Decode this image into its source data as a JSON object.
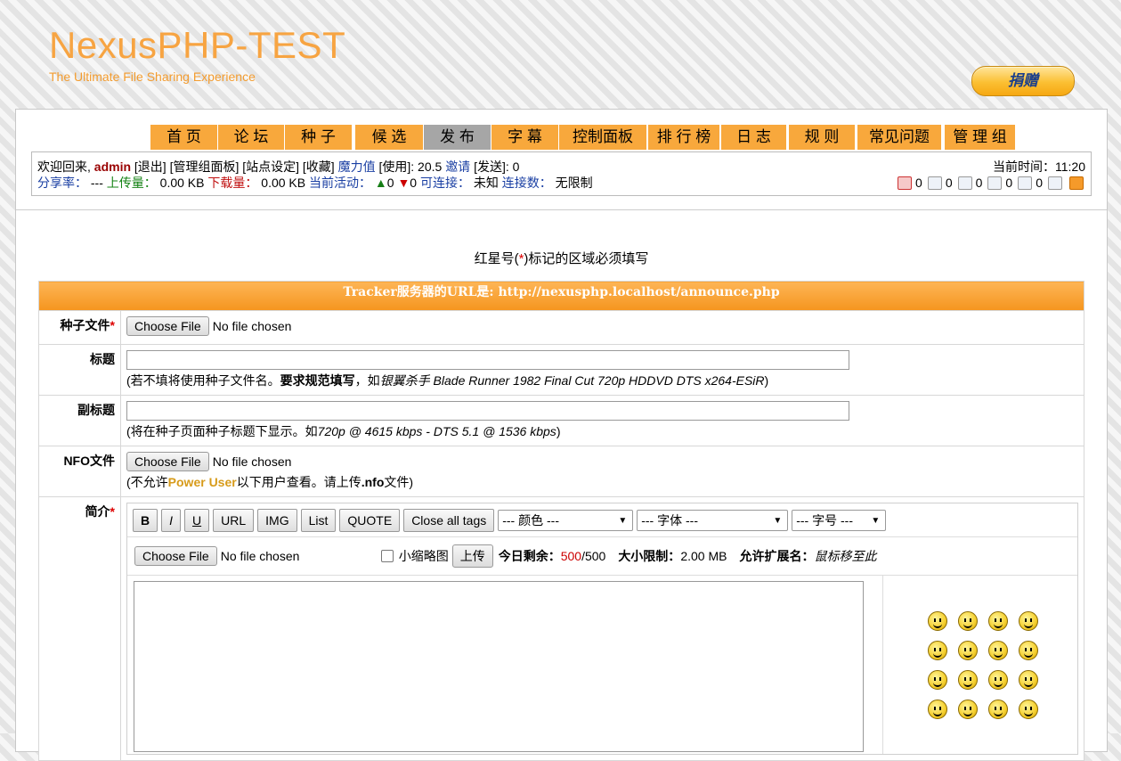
{
  "header": {
    "site_title": "NexusPHP-TEST",
    "slogan": "The Ultimate File Sharing Experience",
    "donate_label": "捐赠"
  },
  "nav": {
    "items": [
      {
        "label": "首 页"
      },
      {
        "label": "论 坛"
      },
      {
        "label": "种 子"
      },
      {
        "label": "候 选"
      },
      {
        "label": "发 布",
        "active": true
      },
      {
        "label": "字 幕"
      },
      {
        "label": "控制面板"
      },
      {
        "label": "排 行 榜"
      },
      {
        "label": "日 志"
      },
      {
        "label": "规 则"
      },
      {
        "label": "常见问题"
      },
      {
        "label": "管 理 组"
      }
    ]
  },
  "userbar": {
    "welcome": "欢迎回来,",
    "username": "admin",
    "logout": "[退出]",
    "staff_panel": "[管理组面板]",
    "site_settings": "[站点设定]",
    "favorites": "[收藏]",
    "bonus_label": "魔力值",
    "bonus_use": "[使用]: 20.5",
    "invite_label": "邀请",
    "invite_send": "[发送]: 0",
    "ratio_label": "分享率：",
    "ratio_value": "---",
    "uploaded_label": "上传量：",
    "uploaded_value": "0.00 KB",
    "downloaded_label": "下载量：",
    "downloaded_value": "0.00 KB",
    "active_label": "当前活动：",
    "seeding": "0",
    "leeching": "0",
    "connectable_label": "可连接：",
    "connectable_value": "未知",
    "connections_label": "连接数：",
    "connections_value": "无限制",
    "time_label": "当前时间：",
    "time_value": "11:20",
    "counters": [
      "0",
      "0",
      "0",
      "0",
      "0"
    ]
  },
  "form": {
    "required_notice_pre": "红星号(",
    "required_notice_star": "*",
    "required_notice_post": ")标记的区域必须填写",
    "tracker_text": "Tracker服务器的URL是:    http://nexusphp.localhost/announce.php",
    "torrent_file_label": "种子文件",
    "title_label": "标题",
    "title_hint_pre": "(若不填将使用种子文件名。",
    "title_hint_bold": "要求规范填写",
    "title_hint_mid": "，如",
    "title_hint_example": "银翼杀手 Blade Runner 1982 Final Cut 720p HDDVD DTS x264-ESiR",
    "title_hint_post": ")",
    "subtitle_label": "副标题",
    "subtitle_hint_pre": "(将在种子页面种子标题下显示。如",
    "subtitle_hint_example": "720p @ 4615 kbps - DTS 5.1 @ 1536 kbps",
    "subtitle_hint_post": ")",
    "nfo_label": "NFO文件",
    "nfo_hint_pre": "(不允许",
    "nfo_hint_power": "Power User",
    "nfo_hint_mid": "以下用户查看。请上传",
    "nfo_hint_ext": ".nfo",
    "nfo_hint_post": "文件)",
    "desc_label": "简介",
    "required_star": "*",
    "choose_file": "Choose File",
    "no_file": "No file chosen"
  },
  "editor": {
    "buttons": [
      "B",
      "I",
      "U",
      "URL",
      "IMG",
      "List",
      "QUOTE",
      "Close all tags"
    ],
    "color_select": "--- 颜色 ---",
    "font_select": "--- 字体 ---",
    "size_select": "--- 字号 ---",
    "thumbnail_label": "小缩略图",
    "upload_button": "上传",
    "today_left_label": "今日剩余：",
    "today_left_value": "500",
    "today_left_total": "/500",
    "size_limit_label": "大小限制：",
    "size_limit_value": "2.00 MB",
    "allowed_ext_label": "允许扩展名：",
    "allowed_ext_value": "鼠标移至此"
  }
}
